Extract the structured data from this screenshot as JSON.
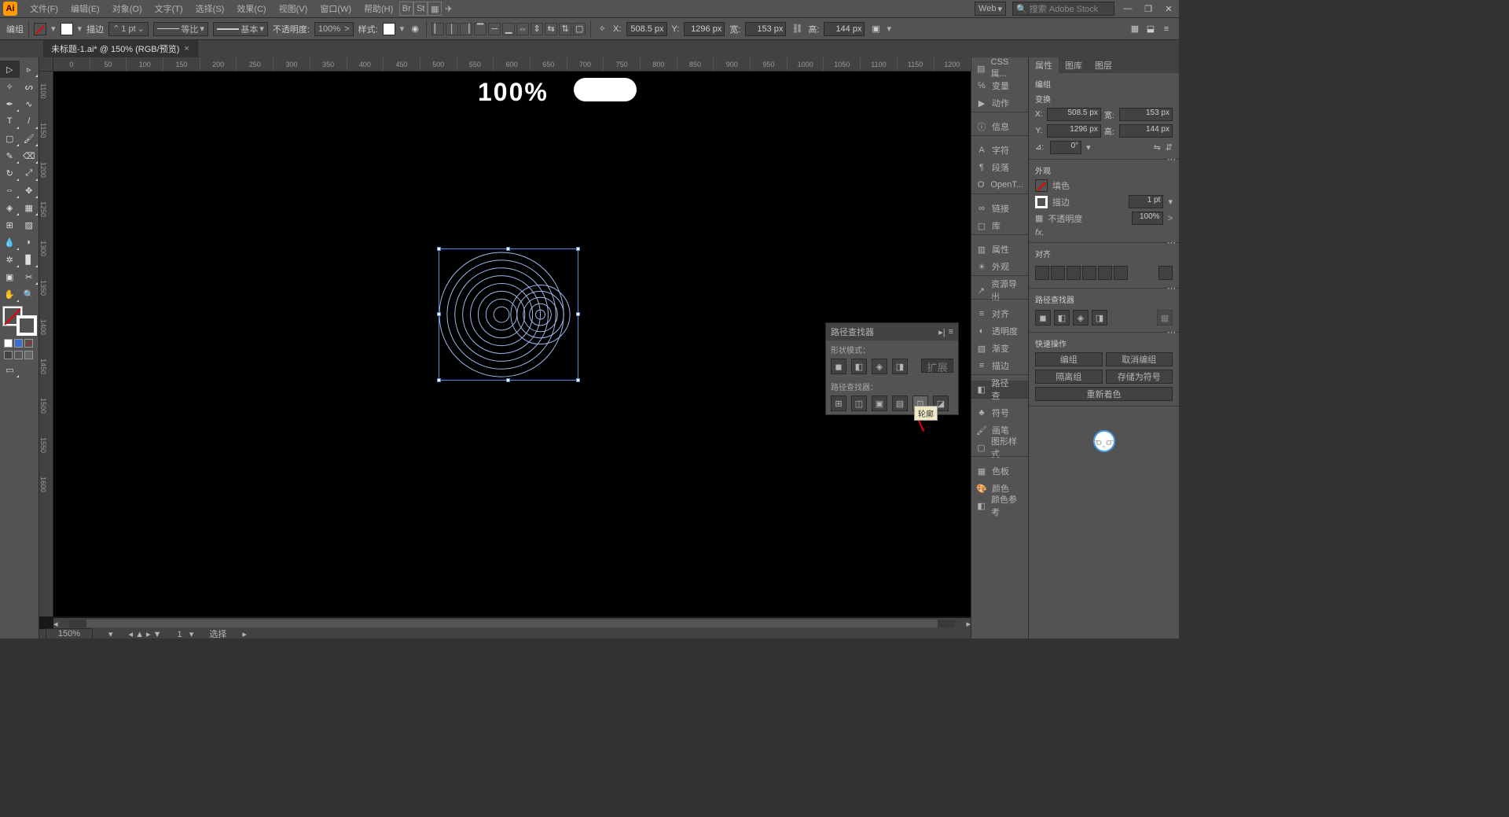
{
  "app_logo": "Ai",
  "menubar": {
    "file": "文件(F)",
    "edit": "编辑(E)",
    "object": "对象(O)",
    "type": "文字(T)",
    "select": "选择(S)",
    "effect": "效果(C)",
    "view": "视图(V)",
    "window": "窗口(W)",
    "help": "帮助(H)",
    "workspace": "Web",
    "search_placeholder": "搜索 Adobe Stock"
  },
  "ctrl": {
    "mode": "编组",
    "stroke_lbl": "描边",
    "stroke_w": "1 pt",
    "dash": "等比",
    "profile": "基本",
    "opacity_lbl": "不透明度:",
    "opacity": "100%",
    "style_lbl": "样式:",
    "x_lbl": "X:",
    "x": "508.5 px",
    "y_lbl": "Y:",
    "y": "1296 px",
    "w_lbl": "宽:",
    "w": "153 px",
    "h_lbl": "高:",
    "h": "144 px"
  },
  "doc": {
    "tab": "未标题-1.ai* @ 150% (RGB/预览)",
    "close": "×"
  },
  "rulers_h": [
    "0",
    "50",
    "100",
    "150",
    "200",
    "250",
    "300",
    "350",
    "400",
    "450",
    "500",
    "550",
    "600",
    "650",
    "700",
    "750",
    "800",
    "850",
    "900",
    "950",
    "1000",
    "1050",
    "1100",
    "1150",
    "1200"
  ],
  "rulers_v": [
    "1100",
    "1150",
    "1200",
    "1250",
    "1300",
    "1350",
    "1400",
    "1450",
    "1500",
    "1550",
    "1600"
  ],
  "canvas": {
    "text": "100%"
  },
  "status": {
    "zoom": "150%",
    "sel": "选择"
  },
  "pathfinder": {
    "title": "路径查找器",
    "shape_modes": "形状模式：",
    "pathfinders": "路径查找器：",
    "expand": "扩展",
    "tooltip": "轮廓"
  },
  "dock": {
    "css": "CSS 属...",
    "vars": "变量",
    "actions": "动作",
    "info": "信息",
    "char": "字符",
    "para": "段落",
    "opentype": "OpenT...",
    "links": "链接",
    "lib": "库",
    "props": "属性",
    "appear": "外观",
    "asset": "资源导出",
    "align": "对齐",
    "transp": "透明度",
    "grad": "渐变",
    "stroke": "描边",
    "pathf": "路径查...",
    "symbols": "符号",
    "brushes": "画笔",
    "gstyles": "图形样式",
    "swatches": "色板",
    "color": "颜色",
    "cguide": "颜色参考"
  },
  "props": {
    "tab_props": "属性",
    "tab_libs": "图库",
    "tab_layers": "图层",
    "group": "编组",
    "transform": "变换",
    "x_lbl": "X:",
    "x": "508.5 px",
    "w_lbl": "宽:",
    "w": "153 px",
    "y_lbl": "Y:",
    "y": "1296 px",
    "h_lbl": "高:",
    "h": "144 px",
    "angle_lbl": "⊿:",
    "angle": "0°",
    "appearance": "外观",
    "fill": "填色",
    "stroke": "描边",
    "stroke_w": "1 pt",
    "opacity_lbl": "不透明度",
    "opacity": "100%",
    "fx": "fx.",
    "align": "对齐",
    "pathfinder": "路径查找器",
    "quick": "快速操作",
    "btn_group": "编组",
    "btn_ungroup": "取消编组",
    "btn_isolate": "隔离组",
    "btn_savesym": "存储为符号",
    "btn_recolor": "重新着色"
  }
}
